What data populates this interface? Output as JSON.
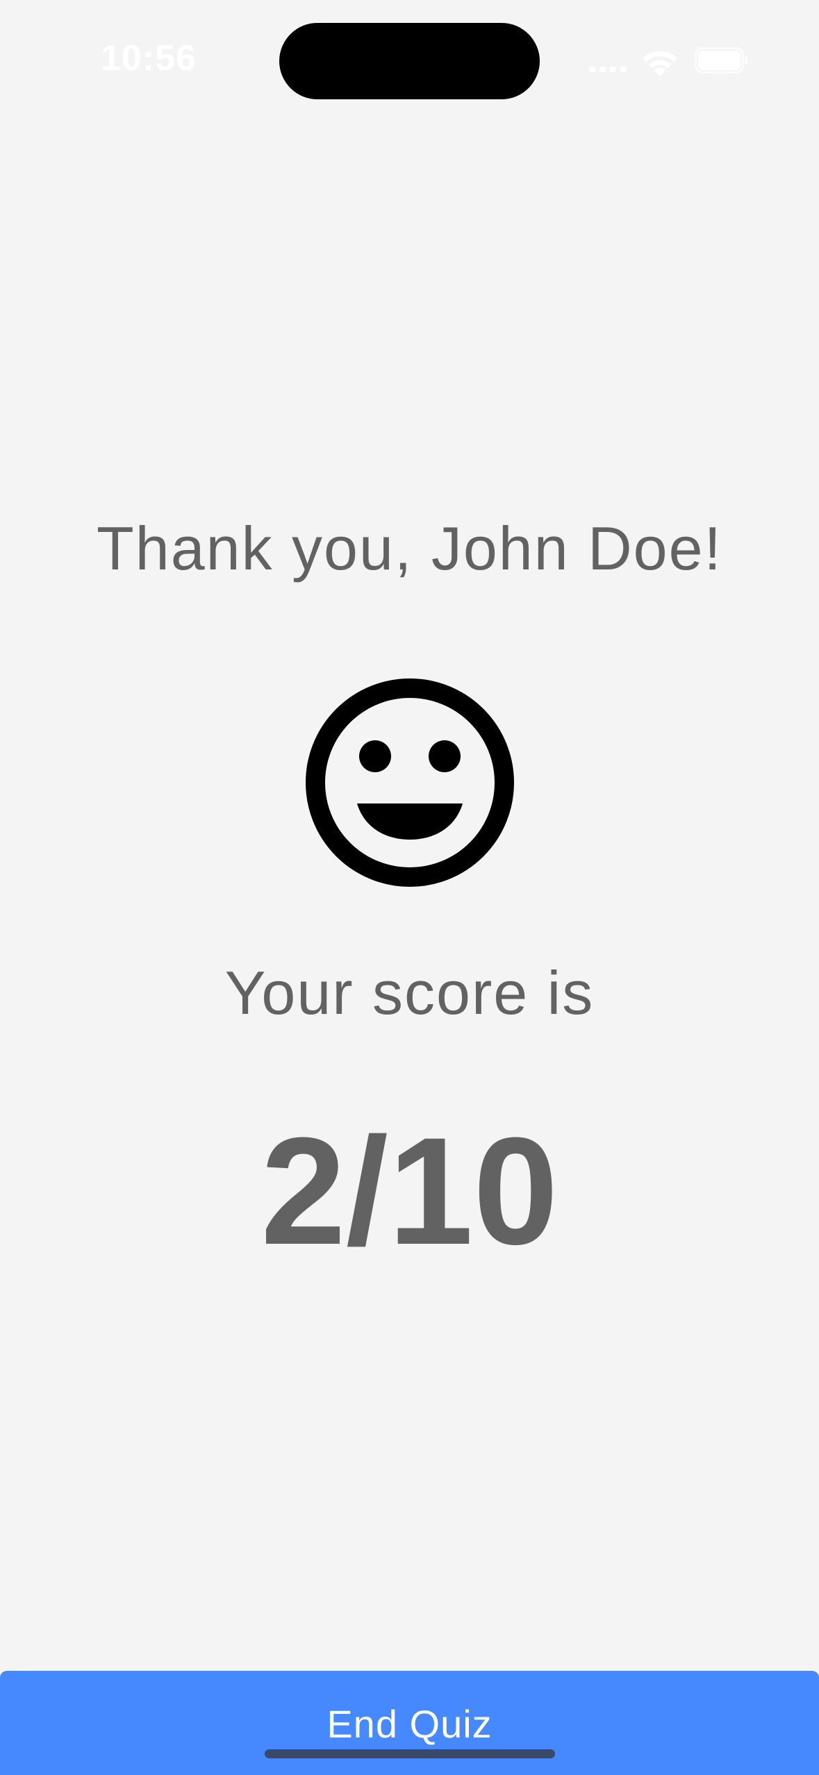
{
  "status_bar": {
    "time": "10:56"
  },
  "results": {
    "thank_you": "Thank you, John Doe!",
    "face_icon": "smiling-face-icon",
    "score_label": "Your score is",
    "score_value": "2/10",
    "score": {
      "correct": 2,
      "total": 10
    }
  },
  "footer": {
    "end_quiz_label": "End Quiz"
  },
  "colors": {
    "background": "#f4f4f4",
    "text": "#626262",
    "button": "#4689fe",
    "button_text": "#ffffff"
  }
}
